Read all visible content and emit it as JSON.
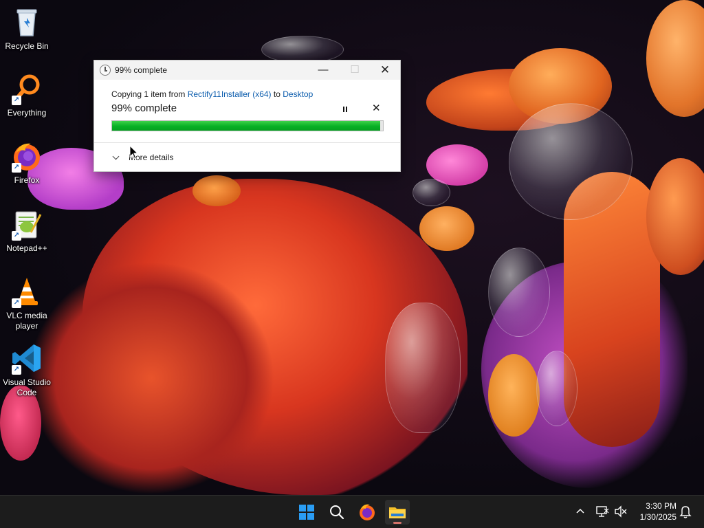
{
  "desktop": {
    "icons": [
      {
        "label": "Recycle Bin",
        "icon": "recycle-bin-icon"
      },
      {
        "label": "Everything",
        "icon": "everything-search-icon"
      },
      {
        "label": "Firefox",
        "icon": "firefox-icon"
      },
      {
        "label": "Notepad++",
        "icon": "notepad-plus-plus-icon"
      },
      {
        "label": "VLC media player",
        "icon": "vlc-icon"
      },
      {
        "label": "Visual Studio Code",
        "icon": "vscode-icon"
      }
    ]
  },
  "dialog": {
    "title": "99% complete",
    "copy_prefix": "Copying 1 item from",
    "source": "Rectify11Installer (x64)",
    "copy_to": "to",
    "destination": "Desktop",
    "status": "99% complete",
    "progress_percent": 99,
    "more_details": "More details",
    "accent": "#06b025"
  },
  "taskbar": {
    "apps": [
      "windows-start-icon",
      "search-icon",
      "firefox-icon",
      "file-explorer-icon"
    ],
    "active_app": "file-explorer-icon"
  },
  "clock": {
    "time": "3:30 PM",
    "date": "1/30/2025"
  }
}
